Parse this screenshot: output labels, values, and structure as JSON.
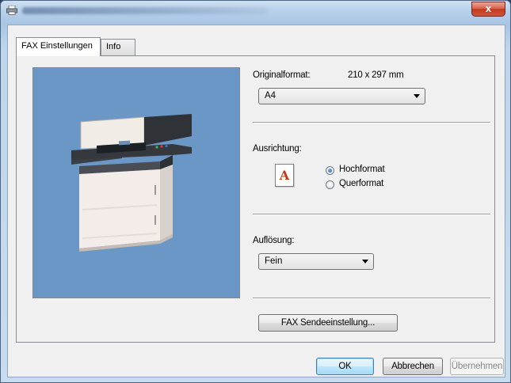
{
  "window": {
    "title": "",
    "close_label": "x"
  },
  "tabs": [
    {
      "label": "FAX Einstellungen",
      "active": true
    },
    {
      "label": "Info",
      "active": false
    }
  ],
  "preview": {
    "device": "multifunction-printer"
  },
  "original_format": {
    "label": "Originalformat:",
    "size_text": "210 x 297 mm",
    "selected": "A4"
  },
  "orientation": {
    "label": "Ausrichtung:",
    "icon_letter": "A",
    "options": [
      {
        "label": "Hochformat",
        "checked": true
      },
      {
        "label": "Querformat",
        "checked": false
      }
    ]
  },
  "resolution": {
    "label": "Auflösung:",
    "selected": "Fein"
  },
  "fax_send_settings_label": "FAX Sendeeinstellung...",
  "footer": {
    "ok_label": "OK",
    "cancel_label": "Abbrechen",
    "apply_label": "Übernehmen"
  },
  "colors": {
    "preview_bg": "#6b97c6",
    "icon_letter_color": "#c03a10"
  }
}
